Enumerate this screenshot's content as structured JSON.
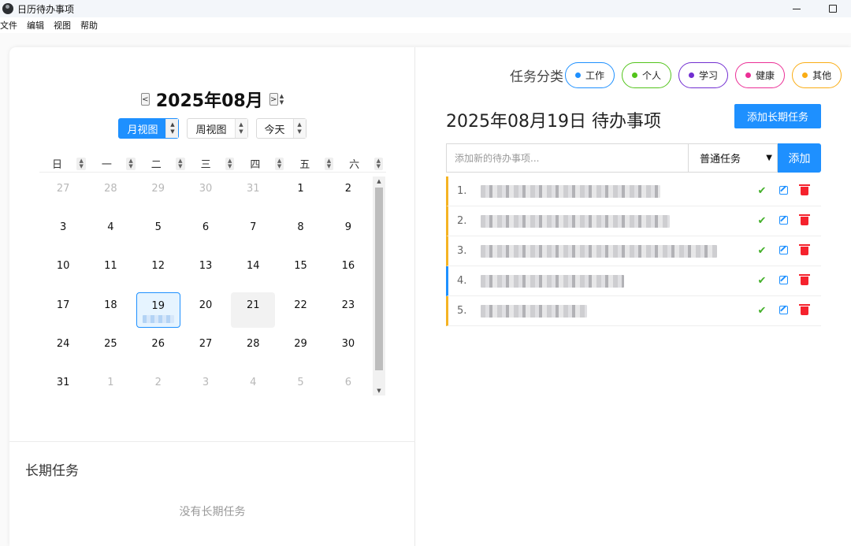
{
  "window": {
    "title": "日历待办事项",
    "min_icon": "minimize-icon",
    "max_icon": "maximize-icon"
  },
  "menu": [
    "文件",
    "编辑",
    "视图",
    "帮助"
  ],
  "calendar": {
    "month_title": "2025年08月",
    "prev_label": "<",
    "next_label": ">",
    "views": [
      {
        "label": "月视图",
        "active": true
      },
      {
        "label": "周视图",
        "active": false
      },
      {
        "label": "今天",
        "active": false
      }
    ],
    "weekdays": [
      "日",
      "一",
      "二",
      "三",
      "四",
      "五",
      "六"
    ],
    "days": [
      {
        "d": "27",
        "other": true
      },
      {
        "d": "28",
        "other": true
      },
      {
        "d": "29",
        "other": true
      },
      {
        "d": "30",
        "other": true
      },
      {
        "d": "31",
        "other": true
      },
      {
        "d": "1"
      },
      {
        "d": "2"
      },
      {
        "d": "3"
      },
      {
        "d": "4"
      },
      {
        "d": "5"
      },
      {
        "d": "6"
      },
      {
        "d": "7"
      },
      {
        "d": "8"
      },
      {
        "d": "9"
      },
      {
        "d": "10"
      },
      {
        "d": "11"
      },
      {
        "d": "12"
      },
      {
        "d": "13"
      },
      {
        "d": "14"
      },
      {
        "d": "15"
      },
      {
        "d": "16"
      },
      {
        "d": "17"
      },
      {
        "d": "18"
      },
      {
        "d": "19",
        "selected": true,
        "event": true
      },
      {
        "d": "20"
      },
      {
        "d": "21",
        "hover": true
      },
      {
        "d": "22"
      },
      {
        "d": "23"
      },
      {
        "d": "24"
      },
      {
        "d": "25"
      },
      {
        "d": "26"
      },
      {
        "d": "27"
      },
      {
        "d": "28"
      },
      {
        "d": "29"
      },
      {
        "d": "30"
      },
      {
        "d": "31"
      },
      {
        "d": "1",
        "other": true
      },
      {
        "d": "2",
        "other": true
      },
      {
        "d": "3",
        "other": true
      },
      {
        "d": "4",
        "other": true
      },
      {
        "d": "5",
        "other": true
      },
      {
        "d": "6",
        "other": true
      }
    ]
  },
  "long_term": {
    "title": "长期任务",
    "empty_text": "没有长期任务"
  },
  "categories": {
    "label": "任务分类",
    "items": [
      {
        "label": "工作",
        "color": "#1e90ff"
      },
      {
        "label": "个人",
        "color": "#52c41a"
      },
      {
        "label": "学习",
        "color": "#722ed1"
      },
      {
        "label": "健康",
        "color": "#eb2f96"
      },
      {
        "label": "其他",
        "color": "#faad14"
      }
    ]
  },
  "todo": {
    "date_title": "2025年08月19日 待办事项",
    "add_long_label": "添加长期任务",
    "input_placeholder": "添加新的待办事项...",
    "type_selected": "普通任务",
    "add_label": "添加",
    "tasks": [
      {
        "num": "1.",
        "color": "#f5b323",
        "blur_width": 228
      },
      {
        "num": "2.",
        "color": "#f5b323",
        "blur_width": 240
      },
      {
        "num": "3.",
        "color": "#f5b323",
        "blur_width": 300
      },
      {
        "num": "4.",
        "color": "#1e90ff",
        "blur_width": 182
      },
      {
        "num": "5.",
        "color": "#f5b323",
        "blur_width": 135
      }
    ]
  }
}
